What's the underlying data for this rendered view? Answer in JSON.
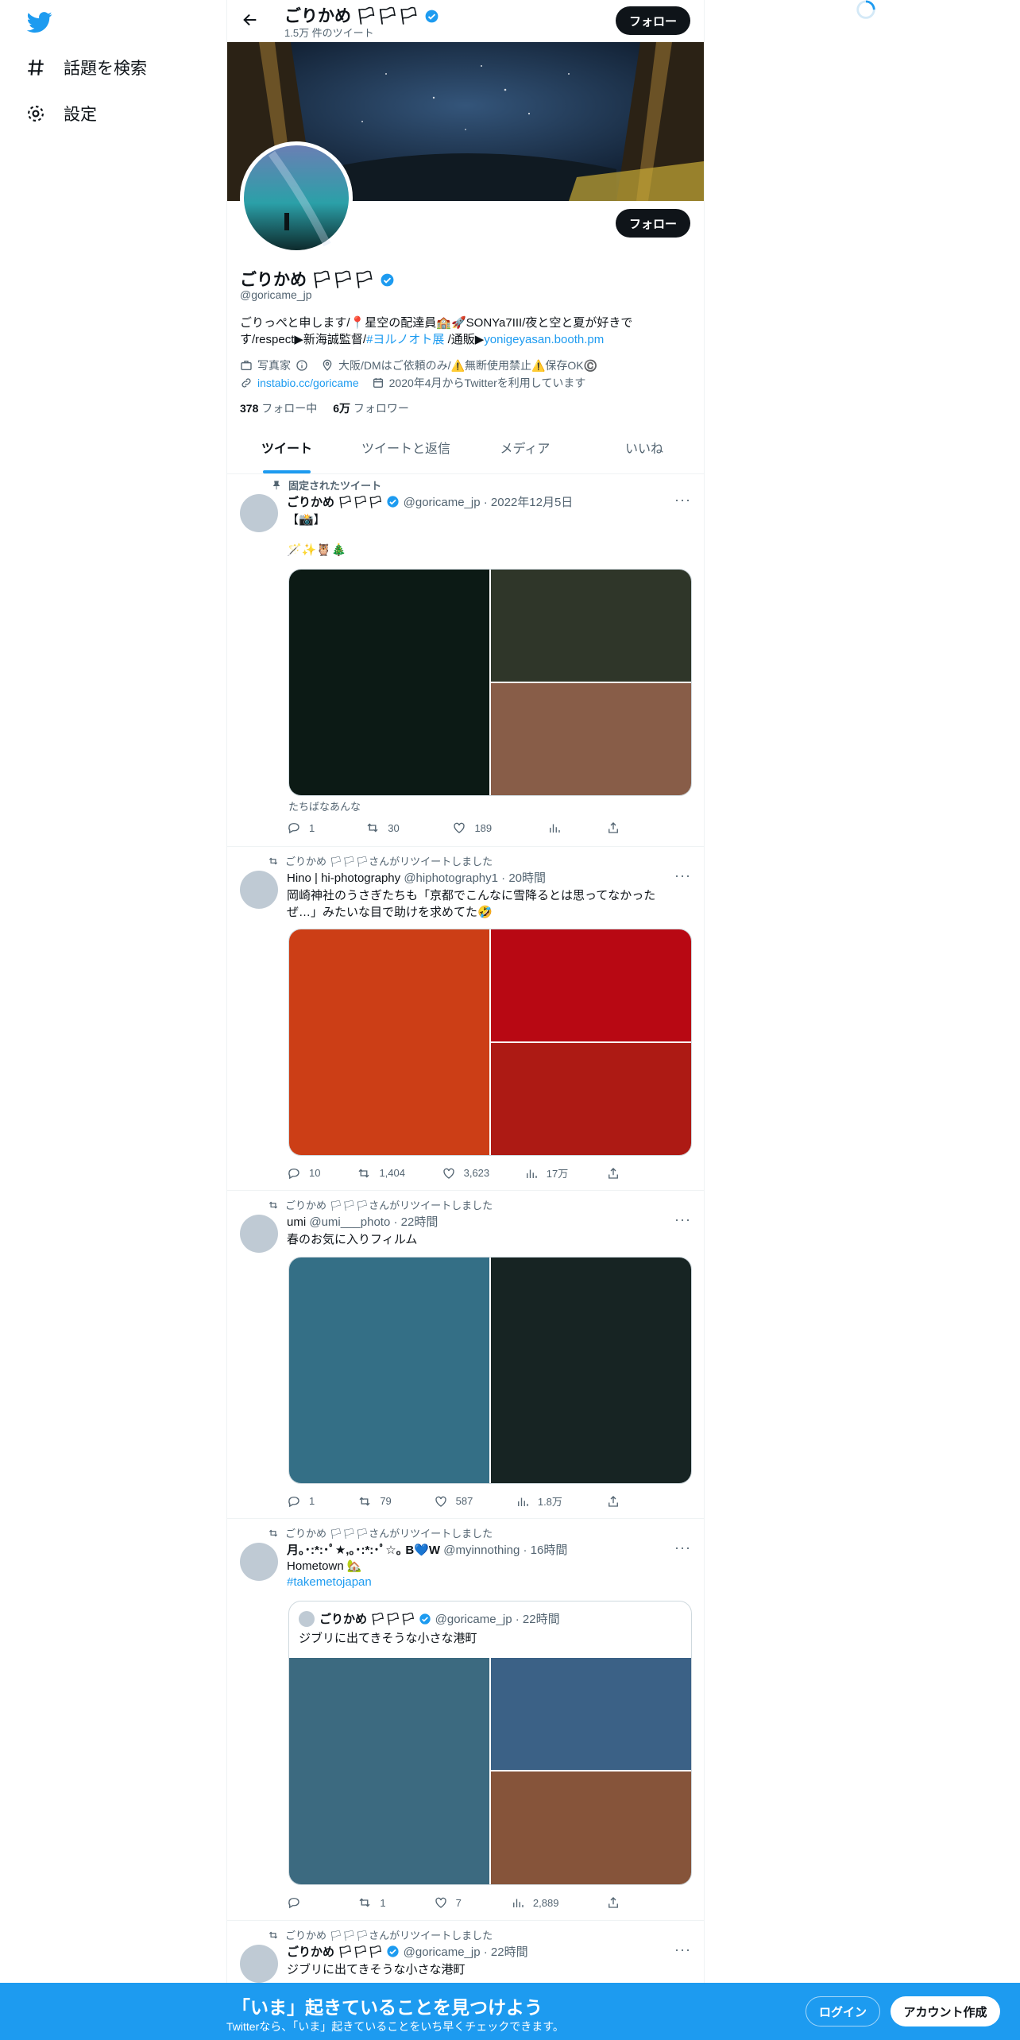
{
  "nav": {
    "items": [
      {
        "label": "話題を検索",
        "icon": "hash-icon"
      },
      {
        "label": "設定",
        "icon": "gear-icon"
      }
    ]
  },
  "header": {
    "name": "ごりかめ 🏳🏳🏳",
    "tweet_count": "1.5万 件のツイート",
    "follow": "フォロー"
  },
  "profile": {
    "name": "ごりかめ 🏳🏳🏳",
    "handle": "@goricame_jp",
    "bio_1": "ごりっぺと申します/",
    "bio_1b": "星空の配達員",
    "bio_1c": "SONYa7III/夜と空と夏が好きで",
    "bio_2": "す/respect▶新海誠監督/",
    "bio_tag": "#ヨルノオト展",
    "bio_2b": " /通販▶",
    "bio_link": "yonigeyasan.booth.pm",
    "category": "写真家",
    "location": "大阪/DMはご依頼のみ/⚠️無断使用禁止⚠️保存OK©️",
    "url": "instabio.cc/goricame",
    "joined": "2020年4月からTwitterを利用しています",
    "following_n": "378",
    "following_l": " フォロー中",
    "followers_n": "6万",
    "followers_l": " フォロワー",
    "follow": "フォロー"
  },
  "tabs": [
    "ツイート",
    "ツイートと返信",
    "メディア",
    "いいね"
  ],
  "tweets": [
    {
      "context": "固定されたツイート",
      "name": "ごりかめ 🏳🏳🏳",
      "handle": "@goricame_jp",
      "time": "· 2022年12月5日",
      "text1": "【📸】",
      "text2": "🪄✨🦉🎄",
      "caption": "たちばなあんな",
      "reply": "1",
      "retweet": "30",
      "like": "189",
      "views": "",
      "colors": [
        "#0c1a15",
        "#2f3629",
        "#885d48"
      ]
    },
    {
      "context": "ごりかめ 🏳🏳🏳さんがリツイートしました",
      "name": "Hino | hi-photography",
      "handle": "@hiphotography1",
      "time": "· 20時間",
      "text1": "岡崎神社のうさぎたちも「京都でこんなに雪降るとは思ってなかった",
      "text2": "ぜ…」みたいな目で助けを求めてた🤣",
      "reply": "10",
      "retweet": "1,404",
      "like": "3,623",
      "views": "17万",
      "colors": [
        "#cc3e16",
        "#b80813",
        "#ad1a14"
      ]
    },
    {
      "context": "ごりかめ 🏳🏳🏳さんがリツイートしました",
      "name": "umi",
      "handle": "@umi___photo",
      "time": "· 22時間",
      "text1": "春のお気に入りフィルム",
      "reply": "1",
      "retweet": "79",
      "like": "587",
      "views": "1.8万",
      "colors": [
        "#346f86",
        "#172423"
      ]
    },
    {
      "context": "ごりかめ 🏳🏳🏳さんがリツイートしました",
      "name": "月｡･:*:･ﾟ★,｡･:*:･ﾟ☆｡ B💙W",
      "handle": "@myinnothing",
      "time": "· 16時間",
      "text1": "Hometown 🏡",
      "tag": "#takemetojapan",
      "quote_name": "ごりかめ 🏳🏳🏳",
      "quote_handle": "@goricame_jp",
      "quote_time": "· 22時間",
      "quote_text": "ジブリに出てきそうな小さな港町",
      "reply": "",
      "retweet": "1",
      "like": "7",
      "views": "2,889",
      "colors": [
        "#3c6a80",
        "#3b6186",
        "#86543a"
      ]
    },
    {
      "context": "ごりかめ 🏳🏳🏳さんがリツイートしました",
      "name": "ごりかめ 🏳🏳🏳",
      "handle": "@goricame_jp",
      "time": "· 22時間",
      "text1": "ジブリに出てきそうな小さな港町"
    }
  ],
  "bottom": {
    "headline": "「いま」起きていることを見つけよう",
    "sub": "Twitterなら、「いま」起きていることをいち早くチェックできます。",
    "login": "ログイン",
    "signup": "アカウント作成"
  },
  "colors": {
    "accent": "#1d9bf0",
    "text": "#0f1419",
    "muted": "#536471"
  }
}
